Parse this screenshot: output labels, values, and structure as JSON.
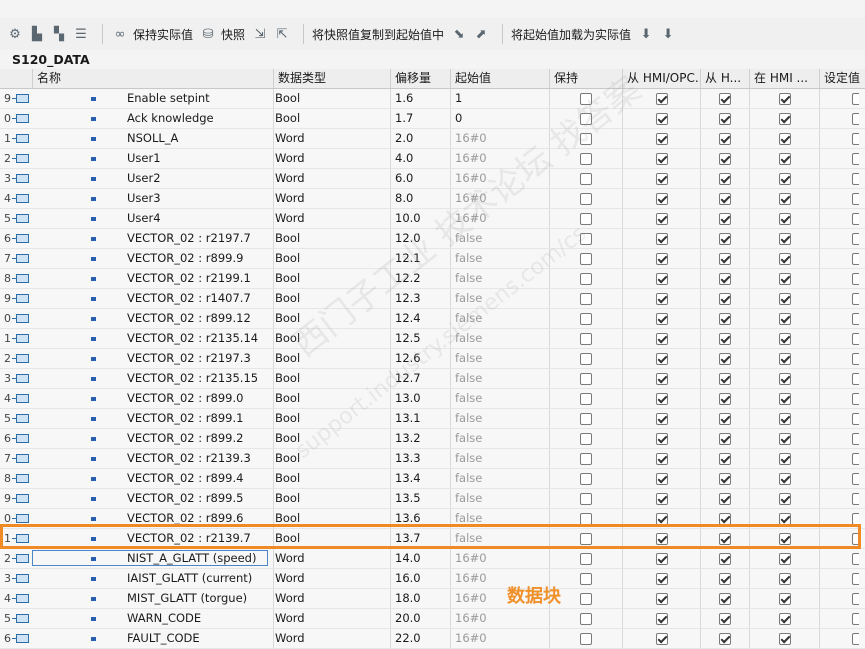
{
  "toolbar": {
    "keep_actual_values": "保持实际值",
    "snapshot": "快照",
    "copy_snapshot_to_start": "将快照值复制到起始值中",
    "load_start_as_actual": "将起始值加载为实际值"
  },
  "db_title": "S120_DATA",
  "columns": {
    "name": "名称",
    "datatype": "数据类型",
    "offset": "偏移量",
    "start": "起始值",
    "retain": "保持",
    "hmi_opc": "从 HMI/OPC...",
    "hmi_h": "从 H...",
    "hmi_in": "在 HMI ...",
    "setpoint": "设定值"
  },
  "rows": [
    {
      "num": "9",
      "name": "Enable setpint",
      "type": "Bool",
      "offset": "1.6",
      "start": "1",
      "start_default": false,
      "retain": false,
      "hmi1": true,
      "hmi2": true,
      "hmi3": true
    },
    {
      "num": "0",
      "name": "Ack knowledge",
      "type": "Bool",
      "offset": "1.7",
      "start": "0",
      "start_default": false,
      "retain": false,
      "hmi1": true,
      "hmi2": true,
      "hmi3": true
    },
    {
      "num": "1",
      "name": "NSOLL_A",
      "type": "Word",
      "offset": "2.0",
      "start": "16#0",
      "start_default": true,
      "retain": false,
      "hmi1": true,
      "hmi2": true,
      "hmi3": true
    },
    {
      "num": "2",
      "name": "User1",
      "type": "Word",
      "offset": "4.0",
      "start": "16#0",
      "start_default": true,
      "retain": false,
      "hmi1": true,
      "hmi2": true,
      "hmi3": true
    },
    {
      "num": "3",
      "name": "User2",
      "type": "Word",
      "offset": "6.0",
      "start": "16#0",
      "start_default": true,
      "retain": false,
      "hmi1": true,
      "hmi2": true,
      "hmi3": true
    },
    {
      "num": "4",
      "name": "User3",
      "type": "Word",
      "offset": "8.0",
      "start": "16#0",
      "start_default": true,
      "retain": false,
      "hmi1": true,
      "hmi2": true,
      "hmi3": true
    },
    {
      "num": "5",
      "name": "User4",
      "type": "Word",
      "offset": "10.0",
      "start": "16#0",
      "start_default": true,
      "retain": false,
      "hmi1": true,
      "hmi2": true,
      "hmi3": true
    },
    {
      "num": "6",
      "name": "VECTOR_02 : r2197.7",
      "type": "Bool",
      "offset": "12.0",
      "start": "false",
      "start_default": true,
      "retain": false,
      "hmi1": true,
      "hmi2": true,
      "hmi3": true
    },
    {
      "num": "7",
      "name": "VECTOR_02 : r899.9",
      "type": "Bool",
      "offset": "12.1",
      "start": "false",
      "start_default": true,
      "retain": false,
      "hmi1": true,
      "hmi2": true,
      "hmi3": true
    },
    {
      "num": "8",
      "name": "VECTOR_02 : r2199.1",
      "type": "Bool",
      "offset": "12.2",
      "start": "false",
      "start_default": true,
      "retain": false,
      "hmi1": true,
      "hmi2": true,
      "hmi3": true
    },
    {
      "num": "9",
      "name": "VECTOR_02 : r1407.7",
      "type": "Bool",
      "offset": "12.3",
      "start": "false",
      "start_default": true,
      "retain": false,
      "hmi1": true,
      "hmi2": true,
      "hmi3": true
    },
    {
      "num": "0",
      "name": "VECTOR_02 : r899.12",
      "type": "Bool",
      "offset": "12.4",
      "start": "false",
      "start_default": true,
      "retain": false,
      "hmi1": true,
      "hmi2": true,
      "hmi3": true
    },
    {
      "num": "1",
      "name": "VECTOR_02 : r2135.14",
      "type": "Bool",
      "offset": "12.5",
      "start": "false",
      "start_default": true,
      "retain": false,
      "hmi1": true,
      "hmi2": true,
      "hmi3": true
    },
    {
      "num": "2",
      "name": "VECTOR_02 : r2197.3",
      "type": "Bool",
      "offset": "12.6",
      "start": "false",
      "start_default": true,
      "retain": false,
      "hmi1": true,
      "hmi2": true,
      "hmi3": true
    },
    {
      "num": "3",
      "name": "VECTOR_02 : r2135.15",
      "type": "Bool",
      "offset": "12.7",
      "start": "false",
      "start_default": true,
      "retain": false,
      "hmi1": true,
      "hmi2": true,
      "hmi3": true
    },
    {
      "num": "4",
      "name": "VECTOR_02 : r899.0",
      "type": "Bool",
      "offset": "13.0",
      "start": "false",
      "start_default": true,
      "retain": false,
      "hmi1": true,
      "hmi2": true,
      "hmi3": true
    },
    {
      "num": "5",
      "name": "VECTOR_02 : r899.1",
      "type": "Bool",
      "offset": "13.1",
      "start": "false",
      "start_default": true,
      "retain": false,
      "hmi1": true,
      "hmi2": true,
      "hmi3": true
    },
    {
      "num": "6",
      "name": "VECTOR_02 : r899.2",
      "type": "Bool",
      "offset": "13.2",
      "start": "false",
      "start_default": true,
      "retain": false,
      "hmi1": true,
      "hmi2": true,
      "hmi3": true
    },
    {
      "num": "7",
      "name": "VECTOR_02 : r2139.3",
      "type": "Bool",
      "offset": "13.3",
      "start": "false",
      "start_default": true,
      "retain": false,
      "hmi1": true,
      "hmi2": true,
      "hmi3": true
    },
    {
      "num": "8",
      "name": "VECTOR_02 : r899.4",
      "type": "Bool",
      "offset": "13.4",
      "start": "false",
      "start_default": true,
      "retain": false,
      "hmi1": true,
      "hmi2": true,
      "hmi3": true
    },
    {
      "num": "9",
      "name": "VECTOR_02 : r899.5",
      "type": "Bool",
      "offset": "13.5",
      "start": "false",
      "start_default": true,
      "retain": false,
      "hmi1": true,
      "hmi2": true,
      "hmi3": true
    },
    {
      "num": "0",
      "name": "VECTOR_02 : r899.6",
      "type": "Bool",
      "offset": "13.6",
      "start": "false",
      "start_default": true,
      "retain": false,
      "hmi1": true,
      "hmi2": true,
      "hmi3": true
    },
    {
      "num": "1",
      "name": "VECTOR_02 : r2139.7",
      "type": "Bool",
      "offset": "13.7",
      "start": "false",
      "start_default": true,
      "retain": false,
      "hmi1": true,
      "hmi2": true,
      "hmi3": true
    },
    {
      "num": "2",
      "name": "NIST_A_GLATT (speed)",
      "type": "Word",
      "offset": "14.0",
      "start": "16#0",
      "start_default": true,
      "retain": false,
      "hmi1": true,
      "hmi2": true,
      "hmi3": true,
      "selected": true
    },
    {
      "num": "3",
      "name": "IAIST_GLATT (current)",
      "type": "Word",
      "offset": "16.0",
      "start": "16#0",
      "start_default": true,
      "retain": false,
      "hmi1": true,
      "hmi2": true,
      "hmi3": true
    },
    {
      "num": "4",
      "name": "MIST_GLATT (torgue)",
      "type": "Word",
      "offset": "18.0",
      "start": "16#0",
      "start_default": true,
      "retain": false,
      "hmi1": true,
      "hmi2": true,
      "hmi3": true
    },
    {
      "num": "5",
      "name": "WARN_CODE",
      "type": "Word",
      "offset": "20.0",
      "start": "16#0",
      "start_default": true,
      "retain": false,
      "hmi1": true,
      "hmi2": true,
      "hmi3": true
    },
    {
      "num": "6",
      "name": "FAULT_CODE",
      "type": "Word",
      "offset": "22.0",
      "start": "16#0",
      "start_default": true,
      "retain": false,
      "hmi1": true,
      "hmi2": true,
      "hmi3": true
    }
  ],
  "annotation": "数据块",
  "watermark": "西门子工业 技术论坛 找答案",
  "watermark_url": "support.industry.siemens.com/cs",
  "colors": {
    "highlight": "#f08a24",
    "selection_border": "#4a86c8",
    "db_icon": "#2d6ea8"
  }
}
